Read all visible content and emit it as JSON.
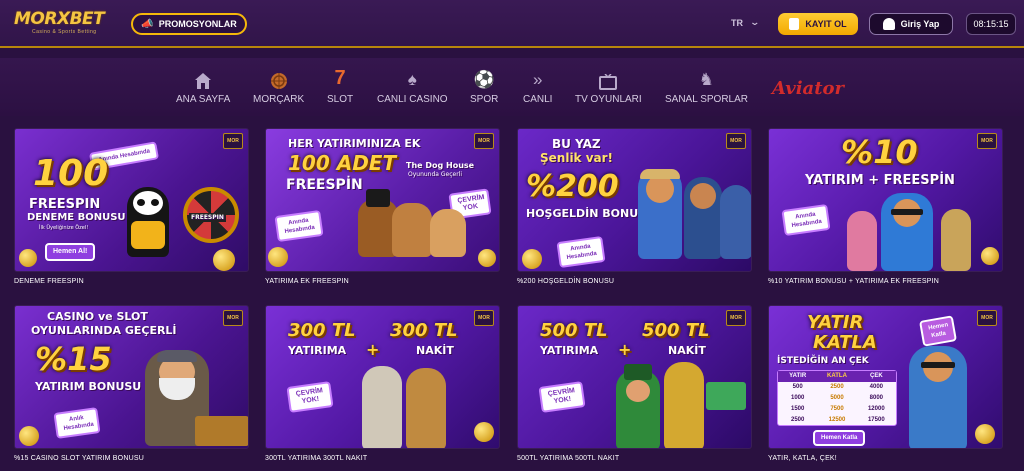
{
  "header": {
    "logo_text": "MORXBET",
    "logo_tagline": "Casino & Sports Betting",
    "promo_label": "PROMOSYONLAR",
    "lang": "TR",
    "register_label": "KAYIT OL",
    "login_label": "Giriş Yap",
    "clock": "08:15:15",
    "colors": {
      "accent": "#f5b80a",
      "bg": "#2a1140"
    }
  },
  "nav": {
    "items": [
      {
        "label": "ANA SAYFA",
        "icon": "home-icon"
      },
      {
        "label": "MORÇARK",
        "icon": "wheel-icon"
      },
      {
        "label": "SLOT",
        "icon": "seven-icon"
      },
      {
        "label": "CANLI CASINO",
        "icon": "spade-icon"
      },
      {
        "label": "SPOR",
        "icon": "ball-icon"
      },
      {
        "label": "CANLI",
        "icon": "double-chevron-icon"
      },
      {
        "label": "TV OYUNLARI",
        "icon": "tv-icon"
      },
      {
        "label": "SANAL SPORLAR",
        "icon": "horse-icon"
      }
    ],
    "aviator": "Aviator"
  },
  "cards": [
    {
      "title": "DENEME FREESPIN",
      "badge": "MOR",
      "big": "100",
      "lines": [
        "FREESPIN",
        "DENEME BONUSU",
        "İlk Üyeliğinize Özel!"
      ],
      "pill": "Anında Hesabında",
      "button": "Hemen Al!",
      "wheel": "FREESPIN"
    },
    {
      "title": "YATIRIMA EK FREESPIN",
      "badge": "MOR",
      "lines": [
        "HER YATIRIMINIZA EK",
        "100 ADET",
        "FREESPİN",
        "The Dog House",
        "Oyununda Geçerli"
      ],
      "pill": "Anında Hesabında",
      "pill2": "ÇEVRİM YOK"
    },
    {
      "title": "%200 HOŞGELDİN BONUSU",
      "badge": "MOR",
      "lines": [
        "BU YAZ",
        "Şenlik var!",
        "%200",
        "HOŞGELDİN BONUSU"
      ],
      "pill": "Anında Hesabında"
    },
    {
      "title": "%10 YATIRIM BONUSU + YATIRIMA EK FREESPIN",
      "badge": "MOR",
      "lines": [
        "%10",
        "YATIRIM + FREESPİN"
      ],
      "pill": "Anında Hesabında"
    },
    {
      "title": "%15 CASINO SLOT YATIRIM BONUSU",
      "badge": "MOR",
      "lines": [
        "CASINO ve SLOT",
        "OYUNLARINDA GEÇERLİ",
        "%15",
        "YATIRIM BONUSU"
      ],
      "pill": "Anlık Hesabında"
    },
    {
      "title": "300TL YATIRIMA 300TL NAKIT",
      "badge": "MOR",
      "lines": [
        "300 TL",
        "YATIRIMA",
        "+",
        "300 TL",
        "NAKİT"
      ],
      "pill": "ÇEVRİM YOK!"
    },
    {
      "title": "500TL YATIRIMA 500TL NAKIT",
      "badge": "MOR",
      "lines": [
        "500 TL",
        "YATIRIMA",
        "+",
        "500 TL",
        "NAKİT"
      ],
      "pill": "ÇEVRİM YOK!"
    },
    {
      "title": "YATIR, KATLA, ÇEK!",
      "badge": "MOR",
      "lines": [
        "YATIR",
        "KATLA",
        "İSTEDİĞİN AN ÇEK"
      ],
      "pill": "Hemen Katla",
      "button": "Hemen Katla",
      "table": {
        "headers": [
          "YATIR",
          "KATLA",
          "ÇEK"
        ],
        "rows": [
          [
            "500",
            "2500",
            "4000"
          ],
          [
            "1000",
            "5000",
            "8000"
          ],
          [
            "1500",
            "7500",
            "12000"
          ],
          [
            "2500",
            "12500",
            "17500"
          ]
        ]
      }
    }
  ]
}
